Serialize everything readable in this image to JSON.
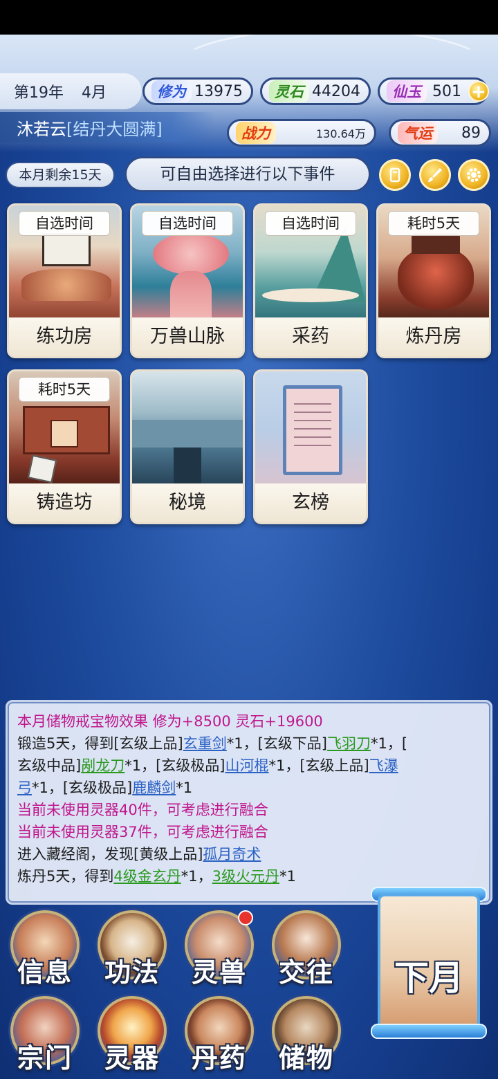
{
  "top": {
    "year": "第19年",
    "month": "4月",
    "cultivation_label": "修为",
    "cultivation_value": "13975",
    "spirit_stone_label": "灵石",
    "spirit_stone_value": "44204",
    "jade_label": "仙玉",
    "jade_value": "501",
    "character_name": "沐若云",
    "character_realm": "[结丹大圆满]",
    "power_label": "战力",
    "power_value": "130.64万",
    "luck_label": "气运",
    "luck_value": "89"
  },
  "events": {
    "days_left": "本月剩余15天",
    "tip": "可自由选择进行以下事件"
  },
  "cards": [
    {
      "name": "练功房",
      "tag": "自选时间"
    },
    {
      "name": "万兽山脉",
      "tag": "自选时间"
    },
    {
      "name": "采药",
      "tag": "自选时间"
    },
    {
      "name": "炼丹房",
      "tag": "耗时5天"
    },
    {
      "name": "铸造坊",
      "tag": "耗时5天"
    },
    {
      "name": "秘境",
      "tag": ""
    },
    {
      "name": "玄榜",
      "tag": ""
    }
  ],
  "log": {
    "line1": "本月储物戒宝物效果 修为+8500 灵石+19600",
    "line2a": "锻造5天，得到[玄级上品]",
    "item1": "玄重剑",
    "line2b": "*1，[玄级下品]",
    "item2": "飞羽刀",
    "line2c": "*1，[",
    "line3a": "玄级中品]",
    "item3": "剐龙刀",
    "line3b": "*1，[玄级极品]",
    "item4": "山河棍",
    "line3c": "*1，[玄级上品]",
    "item5a": "飞瀑",
    "item5b": "弓",
    "line4b": "*1，[玄级极品]",
    "item6": "鹿麟剑",
    "line4c": "*1",
    "line5": "当前未使用灵器40件，可考虑进行融合",
    "line6": "当前未使用灵器37件，可考虑进行融合",
    "line7a": "进入藏经阁，发现[黄级上品]",
    "item7": "孤月奇术",
    "line8a": "炼丹5天，得到",
    "item8": "4级金玄丹",
    "line8b": "*1，",
    "item9": "3级火元丹",
    "line8c": "*1"
  },
  "menu": {
    "info": "信息",
    "skills": "功法",
    "beasts": "灵兽",
    "social": "交往",
    "sect": "宗门",
    "artifacts": "灵器",
    "pills": "丹药",
    "storage": "储物",
    "next_month": "下月"
  },
  "colors": {
    "background": "#1f4da0",
    "log_pink": "#c0168c",
    "log_blue": "#2c62c4",
    "log_green": "#2a9a1f"
  }
}
